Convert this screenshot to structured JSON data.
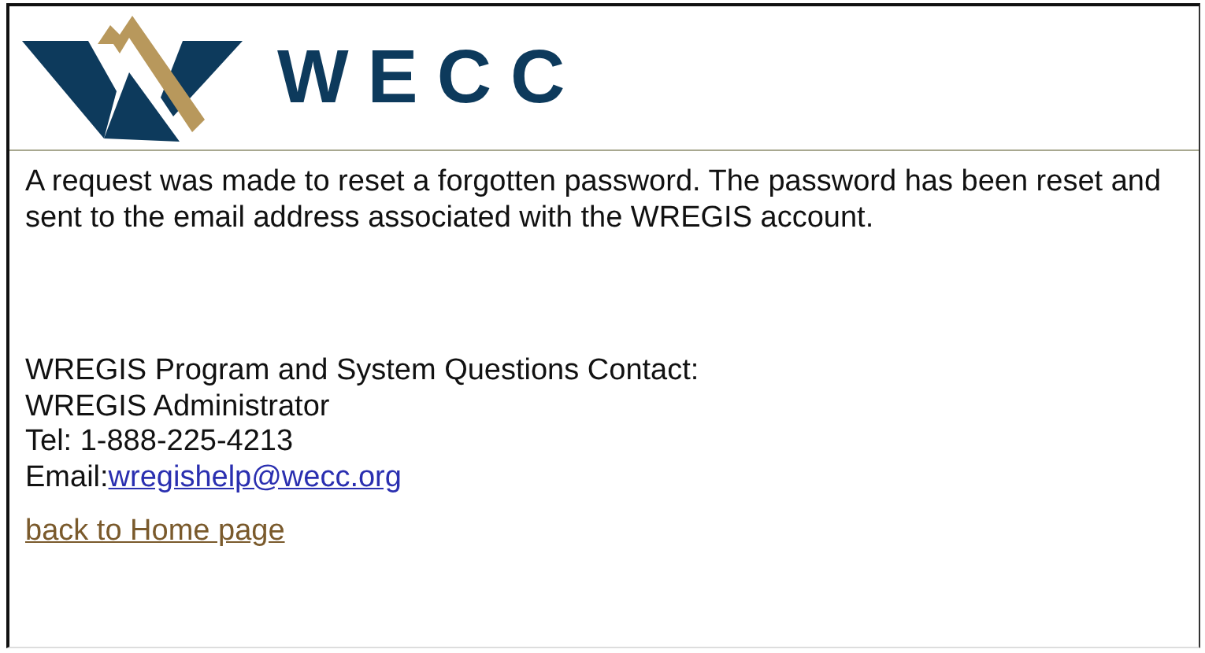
{
  "logo": {
    "text": "WECC"
  },
  "message": "A request was made to reset a forgotten password. The password has been reset and sent to the email address associated with the WREGIS account.",
  "contact": {
    "heading": "WREGIS Program and System Questions Contact:",
    "name": "WREGIS Administrator",
    "tel": "Tel: 1-888-225-4213",
    "email_label": "Email:",
    "email": "wregishelp@wecc.org"
  },
  "home_link": "back to Home page"
}
